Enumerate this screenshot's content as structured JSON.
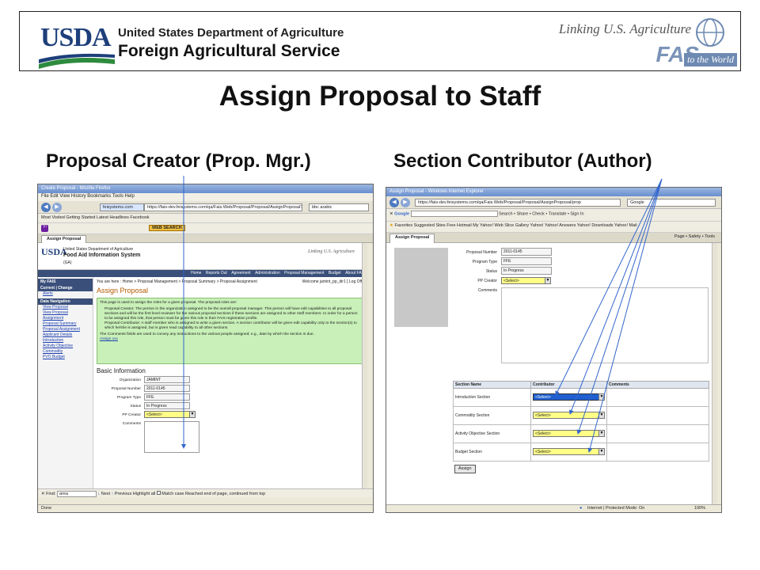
{
  "banner": {
    "usda": "USDA",
    "dept": "United States Department of Agriculture",
    "agency": "Foreign Agricultural Service",
    "tagline": "Linking U.S. Agriculture",
    "fas": "FAS",
    "world": "to the World"
  },
  "title": "Assign Proposal to Staff",
  "left_caption": "Proposal Creator (Prop. Mgr.)",
  "right_caption": "Section Contributor (Author)",
  "left_shot": {
    "window_title": "Create Proposal - Mozilla Firefox",
    "menu": "File  Edit  View  History  Bookmarks  Tools  Help",
    "site_badge": "feisystems.com",
    "url": "https://fais-dev.feisystems.com/qa/Fais.Web/Proposal/Proposal/AssignProposal?...",
    "search_text": "bbc arabic",
    "bookmarks": "Most Visited   Getting Started   Latest Headlines   Facebook",
    "web_search": "WEB SEARCH",
    "tab_label": "Assign Proposal",
    "site_usda": "USDA",
    "site_dept": "United States Department of Agriculture",
    "site_name": "Food Aid Information System",
    "site_ga": "(GA)",
    "site_linking": "Linking U.S. Agriculture",
    "site_nav": [
      "Home",
      "Reports Out",
      "Agreement",
      "Administration",
      "Proposal Management",
      "Budget",
      "About FAS"
    ],
    "side_head1": "My FAIS",
    "side_head2": "Current | Change",
    "side_alerts": "Alerts",
    "side_head3": "Data Navigation",
    "side_links": [
      "View Proposal",
      "View Proposal Assignment",
      "Proposal Summary",
      "Proposal Assignment",
      "Applicant Details",
      "Introduction",
      "Activity Objective",
      "Commodity",
      "PVO Budget"
    ],
    "crumbs": "You are here : Home > Proposal Management > Proposal Summary > Proposal Assignment",
    "welcome": "Welcome jamint_pp_dir1 [ Log Off ]",
    "heading": "Assign Proposal",
    "info_intro": "This page is used to assign the roles for a given proposal. The proposal roles are:",
    "info_b1": "Proposal Creator: The person in the organization assigned to be the overall proposal manager. This person will have edit capabilities to all proposal sections and will be the first level reviewer for the various proposal sections if these sections are assigned to other staff members. In order for a person to be assigned this role, that person must be given this role in their FAIS registration profile.",
    "info_b2": "Proposal Contributor: A staff member who is assigned to write a given section. A section contributor will be given edit capability only to the section(s) to which he/she is assigned, but is given read capability to all other sections.",
    "info_end": "The Comments fields are used to convey any instructions to the various people assigned; e.g., date by which the section is due.",
    "info_link": "Assign xxx",
    "basic_info": "Basic Information",
    "fields": [
      {
        "label": "Organization",
        "value": "JAMINT"
      },
      {
        "label": "Proposal Number",
        "value": "2011-0145"
      },
      {
        "label": "Program Type",
        "value": "FFE"
      },
      {
        "label": "Status",
        "value": "In Progress"
      }
    ],
    "pp_creator_label": "PP Creator",
    "select_value": "<Select>",
    "comments_label": "Comments",
    "find_label": "Find:",
    "find_text": "area",
    "find_next": "Next",
    "find_prev": "Previous",
    "highlight": "Highlight all",
    "match_case": "Match case",
    "find_status": "Reached end of page, continued from top",
    "status": "Done"
  },
  "right_shot": {
    "window_title": "Assign Proposal - Windows Internet Explorer",
    "url": "https://fais-dev.feisystems.com/qa/Fais.Web/Proposal/Proposal/AssignProposal/prop",
    "search_engine": "Google",
    "google_label": "Google",
    "toolbar": "Search  •  Share  •  Check  •  Translate  •  Sign In",
    "favorites": "Favorites   Suggested Sites   Free Hotmail   My Yahoo!   Web Slice Gallery   Yahoo!   Yahoo! Answers   Yahoo! Downloads   Yahoo! Mail",
    "tab_label": "Assign Proposal",
    "tab_tools": "Page  •  Safety  •  Tools",
    "fields": [
      {
        "label": "Proposal Number",
        "value": "2011-0145"
      },
      {
        "label": "Program Type",
        "value": "FFE"
      },
      {
        "label": "Status",
        "value": "In Progress"
      }
    ],
    "pp_creator_label": "PP Creator",
    "select_value": "<Select>",
    "comments_label": "Comments",
    "table": {
      "headers": [
        "Section Name",
        "Contributor",
        "Comments"
      ],
      "rows": [
        {
          "section": "Introduction Section",
          "value": "<Select>"
        },
        {
          "section": "Commodity Section",
          "value": "<Select>"
        },
        {
          "section": "Activity Objective Section",
          "value": "<Select>"
        },
        {
          "section": "Budget Section",
          "value": "<Select>"
        }
      ]
    },
    "assign_label": "Assign",
    "status": "Internet | Protected Mode: On",
    "zoom": "100%"
  },
  "colors": {
    "banner_blue": "#1d3f7a",
    "info_green": "#c8f0b8",
    "select_yellow": "#ffff88",
    "arrow_blue": "#3366cc"
  }
}
